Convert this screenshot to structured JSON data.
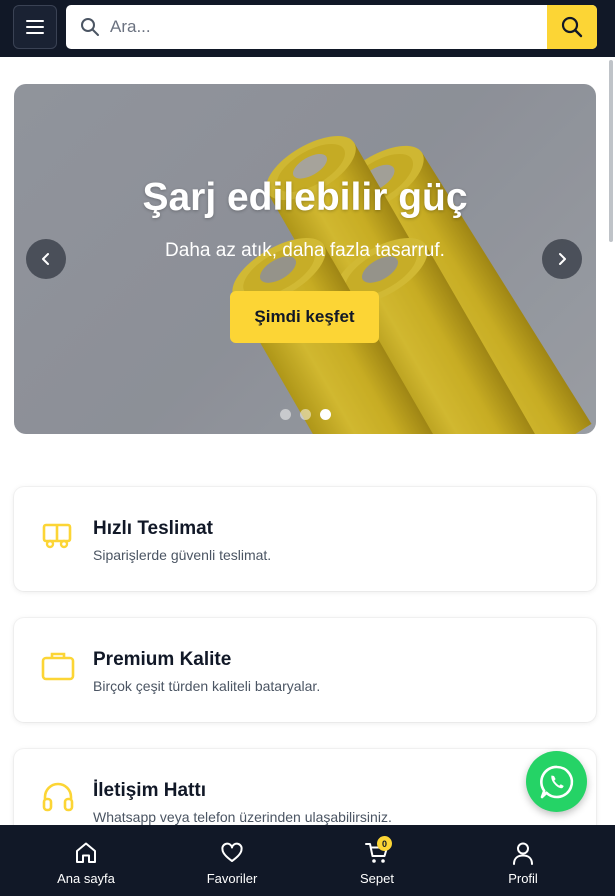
{
  "header": {
    "search_placeholder": "Ara...",
    "icons": {
      "menu": "hamburger-icon",
      "search": "search-icon"
    }
  },
  "hero": {
    "title": "Şarj edilebilir güç",
    "subtitle": "Daha az atık, daha fazla tasarruf.",
    "cta_label": "Şimdi keşfet",
    "slides_total": 3,
    "active_slide": 3
  },
  "features": [
    {
      "icon": "truck-icon",
      "title": "Hızlı Teslimat",
      "description": "Siparişlerde güvenli teslimat."
    },
    {
      "icon": "briefcase-icon",
      "title": "Premium Kalite",
      "description": "Birçok çeşit türden kaliteli bataryalar."
    },
    {
      "icon": "headset-icon",
      "title": "İletişim Hattı",
      "description": "Whatsapp veya telefon üzerinden ulaşabilirsiniz."
    }
  ],
  "bottom_nav": [
    {
      "icon": "home-icon",
      "label": "Ana sayfa"
    },
    {
      "icon": "heart-icon",
      "label": "Favoriler"
    },
    {
      "icon": "cart-icon",
      "label": "Sepet",
      "badge": "0"
    },
    {
      "icon": "user-icon",
      "label": "Profil"
    }
  ],
  "colors": {
    "header_bg": "#111827",
    "accent": "#fcd535",
    "whatsapp": "#25d366"
  }
}
